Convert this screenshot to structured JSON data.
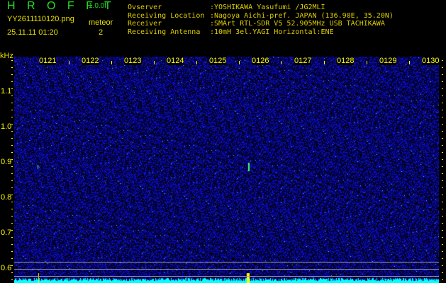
{
  "header": {
    "app_name": "H R O F F T",
    "version": "1.0.0f",
    "filename": "YY2611110120.png",
    "datetime": "25.11.11 01:20",
    "meteor_label": "meteor",
    "meteor_count": "2"
  },
  "info": [
    {
      "label": "Ovserver",
      "value": ":YOSHIKAWA Yasufumi /JG2MLI"
    },
    {
      "label": "Receiving Location",
      "value": ":Nagoya Aichi-pref. JAPAN (136.90E, 35.20N)"
    },
    {
      "label": "Receiver",
      "value": ":SMArt RTL-SDR V5 52.905MHz USB TACHIKAWA"
    },
    {
      "label": "Receiving Antenna",
      "value": ":10mH 3el.YAGI Horizontal:ENE"
    }
  ],
  "spectrogram": {
    "unit_label": "kHz",
    "y_ticks": [
      "1.1",
      "1.0",
      "0.9",
      "0.8",
      "0.7",
      "0.6"
    ],
    "time_labels": [
      "0121",
      "0122",
      "0123",
      "0124",
      "0125",
      "0126",
      "0127",
      "0128",
      "0129",
      "0130"
    ],
    "colors": {
      "noise": "#2020ff",
      "baseline": "#00ffff",
      "axis": "#ffff00"
    }
  }
}
